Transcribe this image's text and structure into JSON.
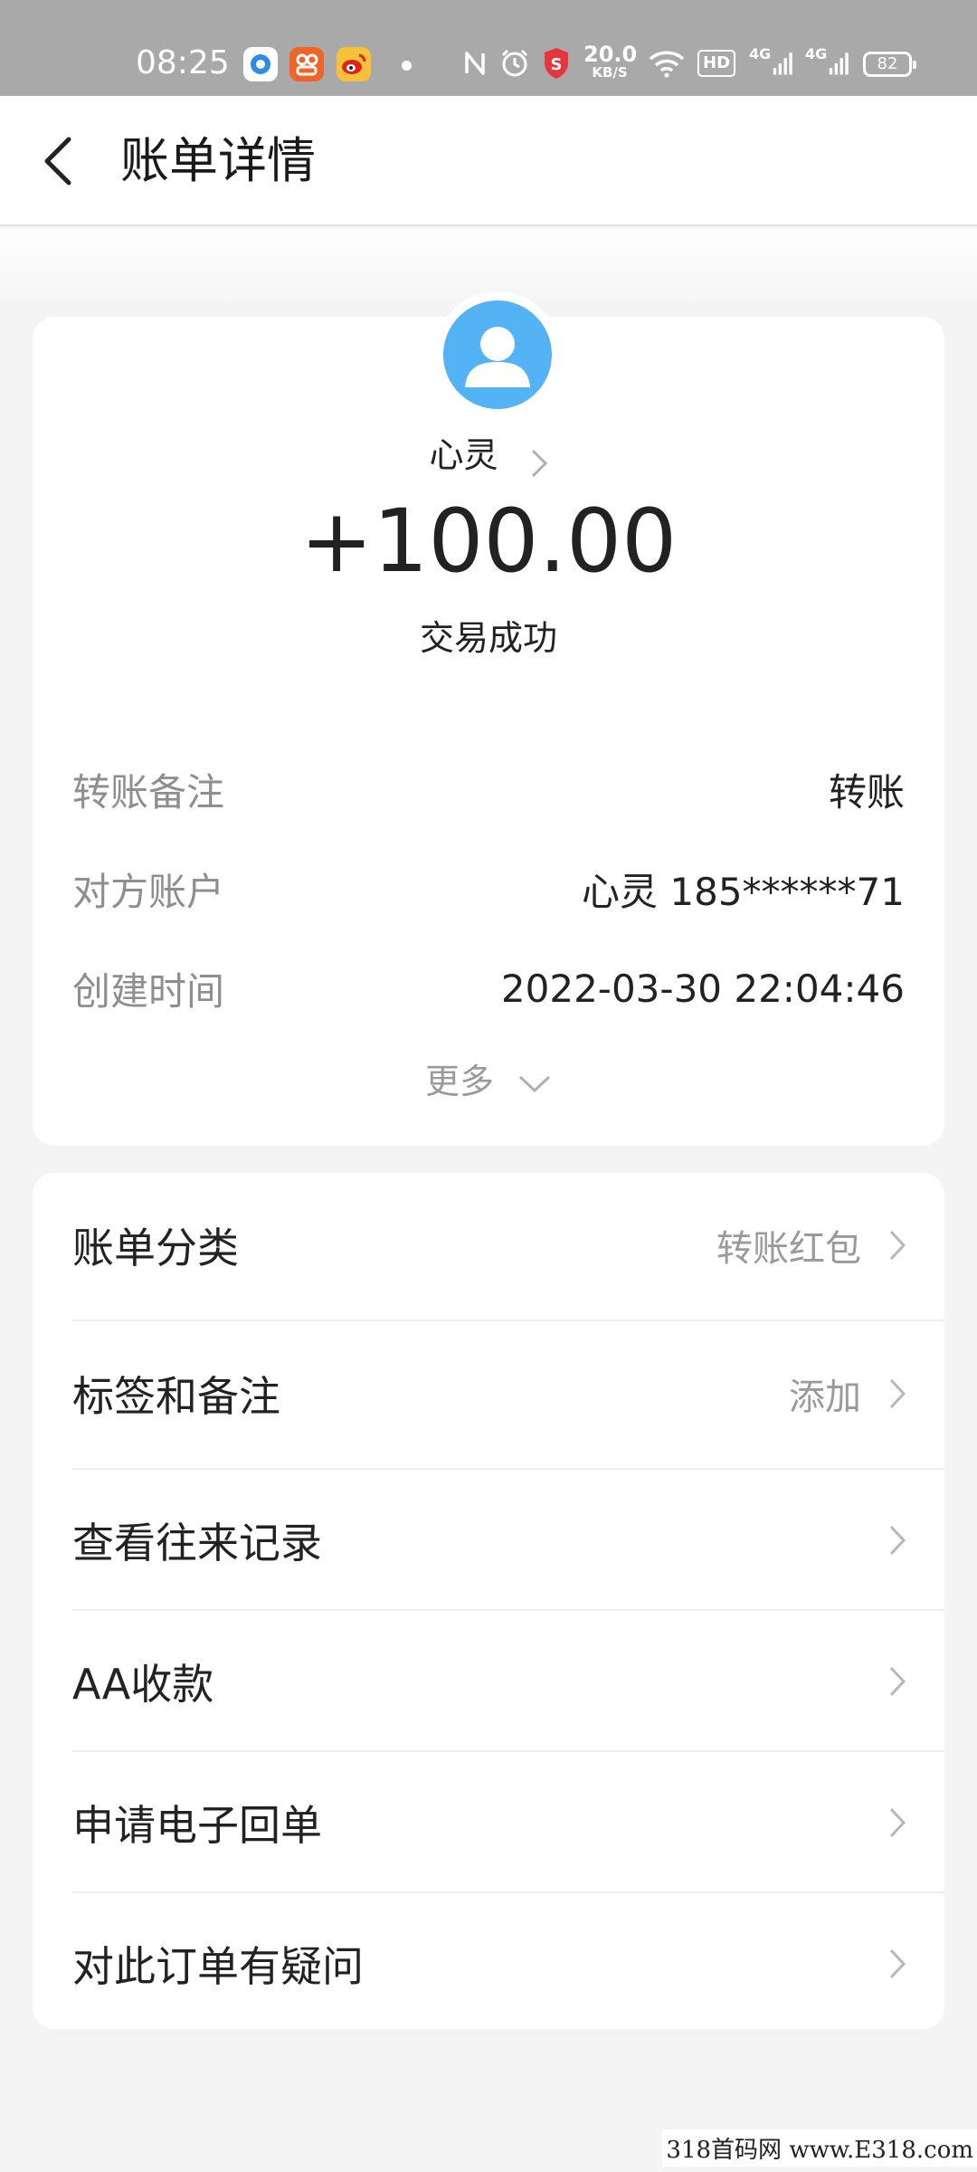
{
  "status_bar": {
    "time": "08:25",
    "net_speed_value": "20.0",
    "net_speed_unit": "KB/S",
    "hd_label": "HD",
    "signal1_label": "4G",
    "signal2_label": "4G",
    "battery": "82",
    "icons": [
      "app-icon-blue",
      "app-icon-orange",
      "weibo-icon",
      "nfc-icon",
      "alarm-icon",
      "shield-icon",
      "wifi-icon",
      "signal-icon",
      "battery-icon"
    ]
  },
  "nav": {
    "title": "账单详情",
    "back_icon": "back-arrow-icon"
  },
  "bill": {
    "payee_name": "心灵",
    "amount": "+100.00",
    "status": "交易成功",
    "details": [
      {
        "label": "转账备注",
        "value": "转账"
      },
      {
        "label": "对方账户",
        "value": "心灵 185******71"
      },
      {
        "label": "创建时间",
        "value": "2022-03-30 22:04:46"
      }
    ],
    "more_label": "更多"
  },
  "menu": {
    "items": [
      {
        "label": "账单分类",
        "value": "转账红包"
      },
      {
        "label": "标签和备注",
        "value": "添加"
      },
      {
        "label": "查看往来记录",
        "value": ""
      },
      {
        "label": "AA收款",
        "value": ""
      },
      {
        "label": "申请电子回单",
        "value": ""
      },
      {
        "label": "对此订单有疑问",
        "value": ""
      }
    ]
  },
  "watermark": "318首码网  www.E318.com",
  "colors": {
    "avatar_blue": "#54b3f5",
    "status_bar_gray": "#a9a9a9",
    "label_gray": "#8e8e8e"
  }
}
